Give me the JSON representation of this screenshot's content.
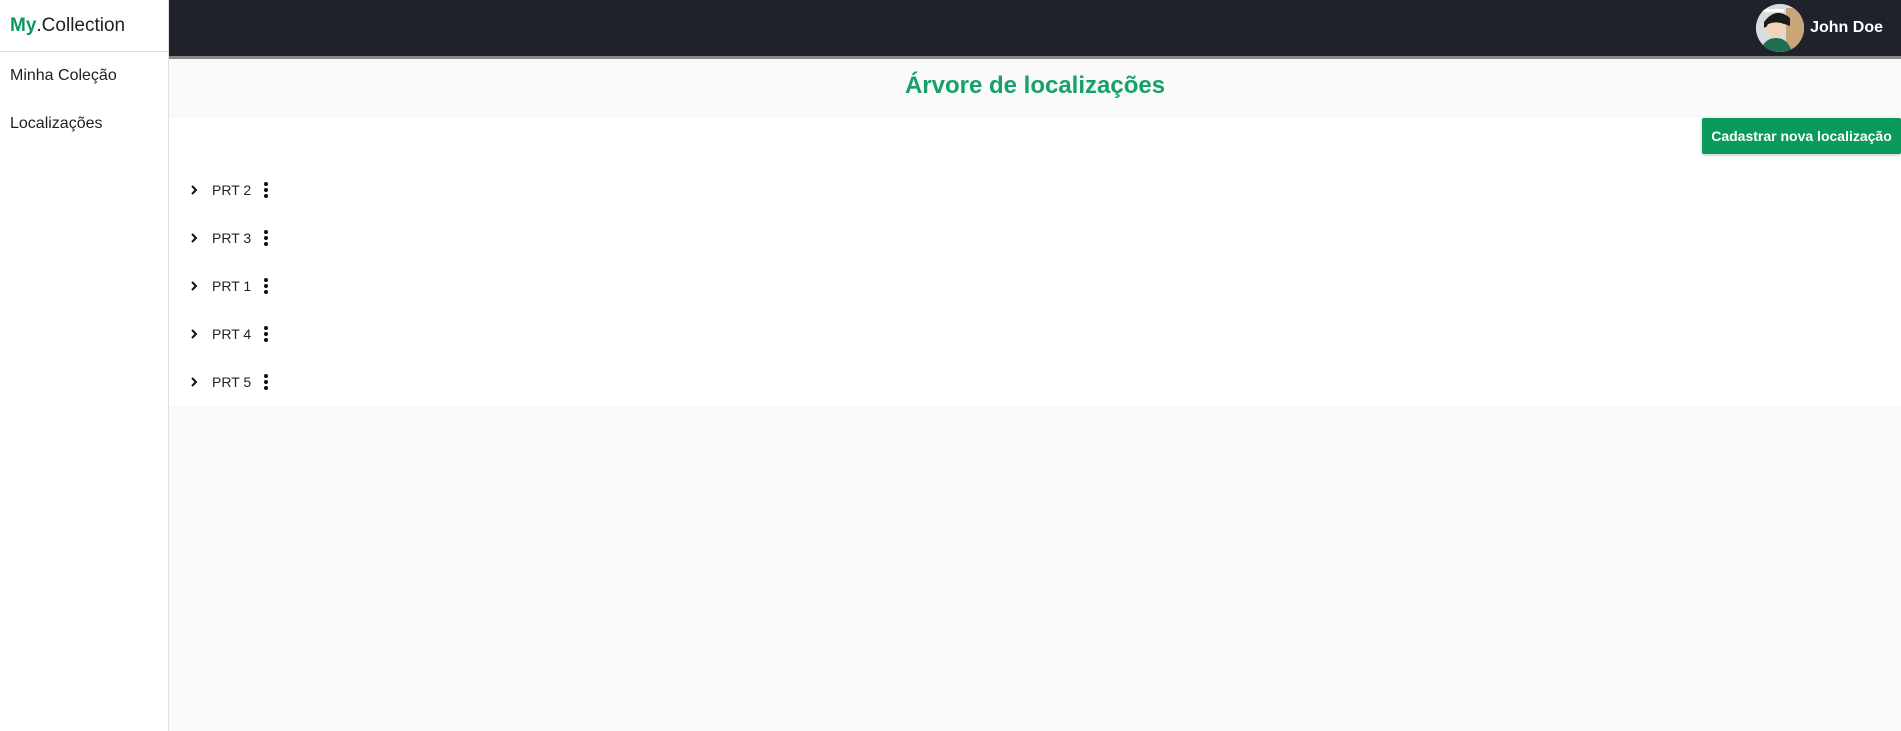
{
  "brand": {
    "bold": "My",
    "rest": ".Collection"
  },
  "sidebar": {
    "items": [
      {
        "label": "Minha Coleção"
      },
      {
        "label": "Localizações"
      }
    ]
  },
  "header": {
    "user_name": "John Doe"
  },
  "main": {
    "title": "Árvore de localizações",
    "add_button_label": "Cadastrar nova localização",
    "tree": [
      {
        "label": "PRT 2"
      },
      {
        "label": "PRT 3"
      },
      {
        "label": "PRT 1"
      },
      {
        "label": "PRT 4"
      },
      {
        "label": "PRT 5"
      }
    ]
  },
  "icons": {
    "expand": "chevron-right-icon",
    "menu": "more-vertical-icon"
  },
  "colors": {
    "accent": "#0a9a5c",
    "title": "#16a06a",
    "topbar": "#1f222b"
  }
}
